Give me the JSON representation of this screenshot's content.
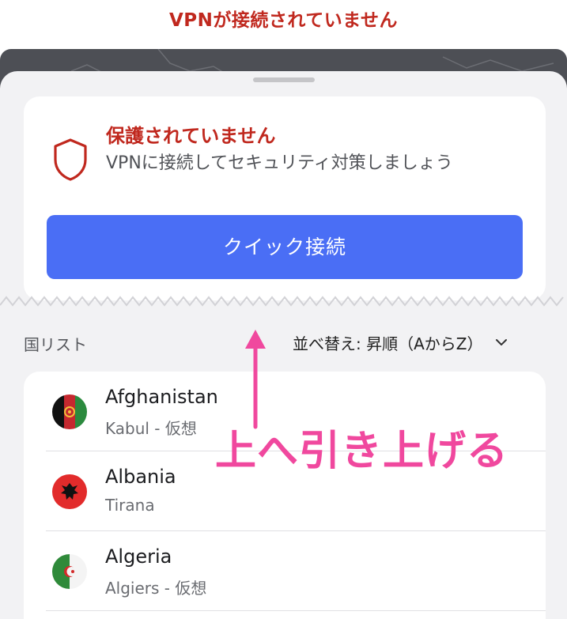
{
  "header": {
    "status": "VPNが接続されていません"
  },
  "protection": {
    "title": "保護されていません",
    "description": "VPNに接続してセキュリティ対策しましょう",
    "quick_connect": "クイック接続"
  },
  "list": {
    "label": "国リスト",
    "sort": "並べ替え: 昇順（AからZ）"
  },
  "countries": [
    {
      "name": "Afghanistan",
      "city": "Kabul - 仮想"
    },
    {
      "name": "Albania",
      "city": "Tirana"
    },
    {
      "name": "Algeria",
      "city": "Algiers - 仮想"
    }
  ],
  "annotation": {
    "text": "上へ引き上げる"
  },
  "colors": {
    "alert_red": "#c0281e",
    "primary_blue": "#4a6ef5",
    "annotation_pink": "#f0489e"
  }
}
